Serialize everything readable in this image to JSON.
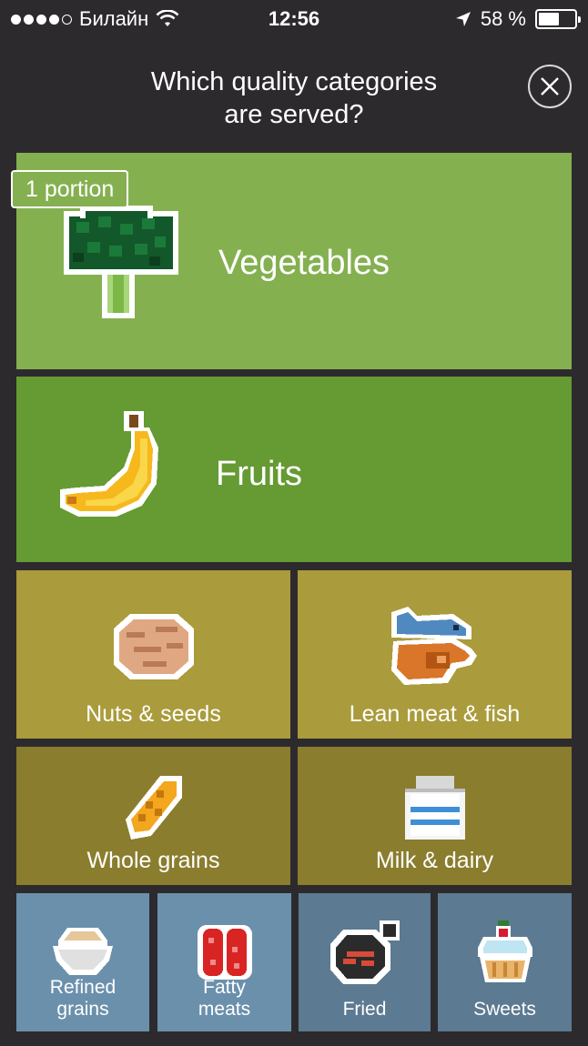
{
  "status_bar": {
    "carrier": "Билайн",
    "time": "12:56",
    "battery": "58 %",
    "battery_fraction": 0.58,
    "signal_bars_filled": 4,
    "signal_bars_total": 5
  },
  "header": {
    "title_line1": "Which quality categories",
    "title_line2": "are served?"
  },
  "categories": {
    "vegetables": {
      "label": "Vegetables",
      "badge": "1 portion",
      "icon": "broccoli-icon",
      "color": "#85b050"
    },
    "fruits": {
      "label": "Fruits",
      "icon": "banana-icon",
      "color": "#669a33"
    },
    "nuts_seeds": {
      "label": "Nuts & seeds",
      "icon": "walnut-icon",
      "color": "#aa9b3c"
    },
    "lean_meat_fish": {
      "label": "Lean meat & fish",
      "icon": "fish-chicken-icon",
      "color": "#aa9b3c"
    },
    "whole_grains": {
      "label": "Whole grains",
      "icon": "wheat-icon",
      "color": "#8a7d2e"
    },
    "milk_dairy": {
      "label": "Milk & dairy",
      "icon": "milk-carton-icon",
      "color": "#8a7d2e"
    },
    "refined_grains": {
      "label_line1": "Refined",
      "label_line2": "grains",
      "icon": "bowl-icon",
      "color": "#6b90ac"
    },
    "fatty_meats": {
      "label_line1": "Fatty",
      "label_line2": "meats",
      "icon": "sausages-icon",
      "color": "#6b90ac"
    },
    "fried": {
      "label": "Fried",
      "icon": "frying-pan-icon",
      "color": "#5c7a92"
    },
    "sweets": {
      "label": "Sweets",
      "icon": "cupcake-icon",
      "color": "#5c7a92"
    }
  }
}
